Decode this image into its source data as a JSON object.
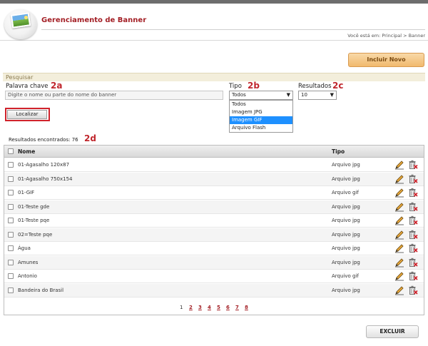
{
  "header": {
    "title": "Gerenciamento de Banner",
    "breadcrumb": "Você está em: Principal > Banner",
    "logo_icon": "banner-picture-icon"
  },
  "toolbar": {
    "include_label": "Incluir Novo"
  },
  "search": {
    "section_title": "Pesquisar",
    "keyword_label": "Palavra chave",
    "keyword_placeholder": "Digite o nome ou parte do nome do banner",
    "type_label": "Tipo",
    "type_selected": "Todos",
    "type_options": [
      "Todos",
      "Imagem JPG",
      "Imagem GIF",
      "Arquivo Flash"
    ],
    "type_highlighted": "Imagem GIF",
    "results_label": "Resultados",
    "results_selected": "10",
    "find_label": "Localizar"
  },
  "annotations": {
    "a2a": "2a",
    "a2b": "2b",
    "a2c": "2c",
    "a2d": "2d"
  },
  "results_found": "Resultados encontrados: 76",
  "table": {
    "columns": [
      "Nome",
      "Tipo"
    ],
    "rows": [
      {
        "name": "01-Agasalho 120x87",
        "type": "Arquivo jpg"
      },
      {
        "name": "01-Agasalho 750x154",
        "type": "Arquivo jpg"
      },
      {
        "name": "01-GIF",
        "type": "Arquivo gif"
      },
      {
        "name": "01-Teste gde",
        "type": "Arquivo jpg"
      },
      {
        "name": "01-Teste pqe",
        "type": "Arquivo jpg"
      },
      {
        "name": "02=Teste pqe",
        "type": "Arquivo jpg"
      },
      {
        "name": "Água",
        "type": "Arquivo jpg"
      },
      {
        "name": "Amunes",
        "type": "Arquivo jpg"
      },
      {
        "name": "Antonio",
        "type": "Arquivo gif"
      },
      {
        "name": "Bandeira do Brasil",
        "type": "Arquivo jpg"
      }
    ]
  },
  "pagination": {
    "pages": [
      "1",
      "2",
      "3",
      "4",
      "5",
      "6",
      "7",
      "8"
    ],
    "current": "1"
  },
  "footer": {
    "delete_label": "EXCLUIR"
  },
  "colors": {
    "brand": "#a31f25",
    "annotation": "#c0272d",
    "include_button": "#f1b96d",
    "highlight": "#1e90ff"
  }
}
